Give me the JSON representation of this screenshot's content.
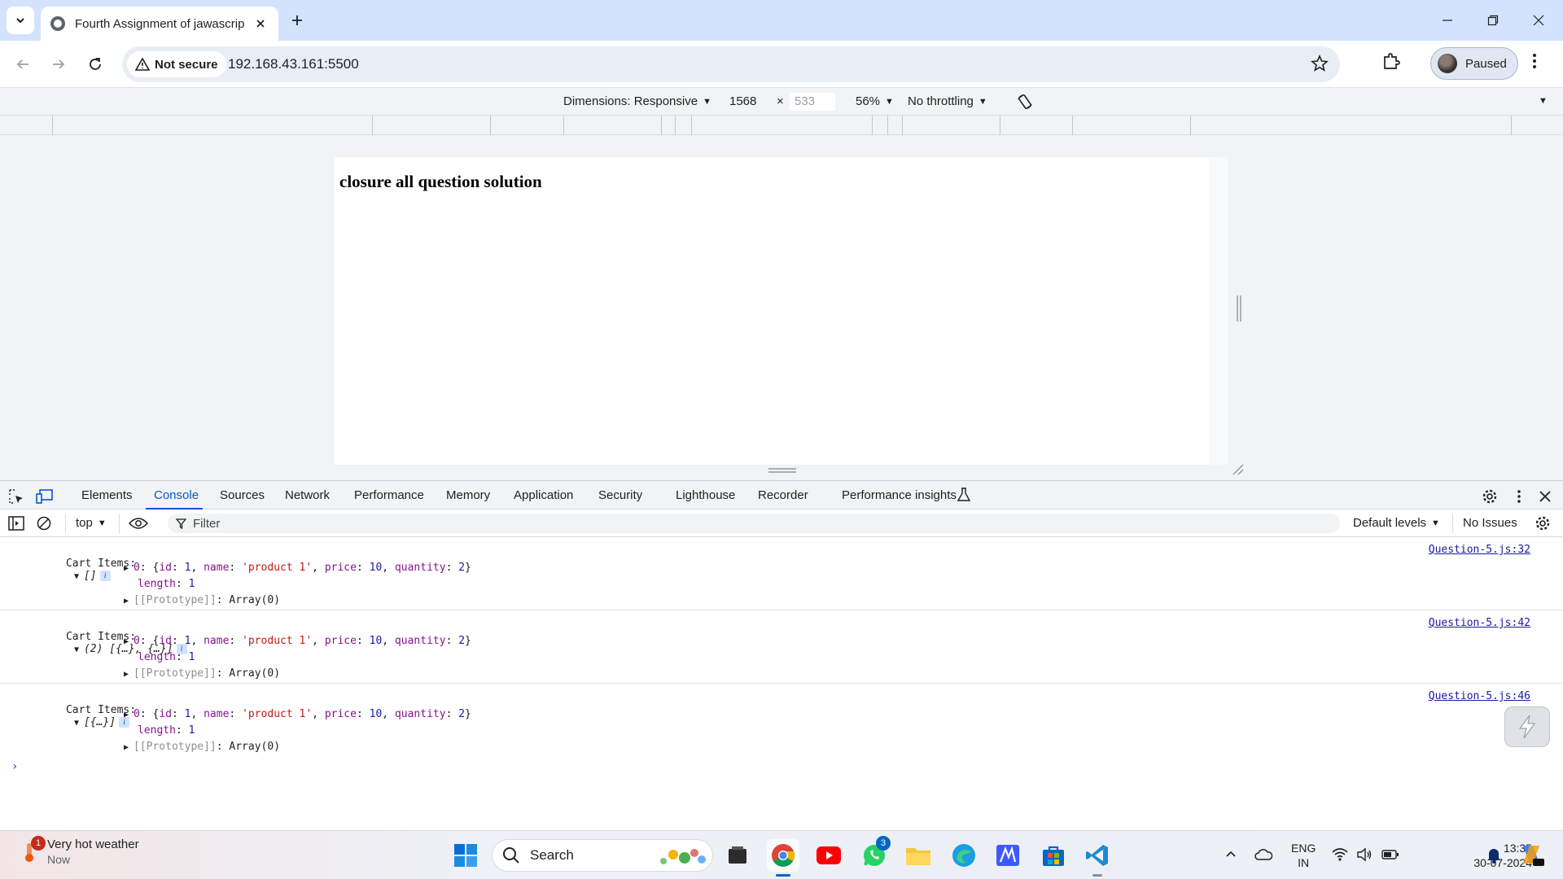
{
  "browser": {
    "tab_title": "Fourth Assignment of jawascrip",
    "security_label": "Not secure",
    "url": "192.168.43.161:5500",
    "profile_label": "Paused"
  },
  "device_toolbar": {
    "dimensions_label": "Dimensions: Responsive",
    "width": "1568",
    "times": "×",
    "height": "533",
    "zoom": "56%",
    "throttling": "No throttling"
  },
  "page": {
    "heading": "closure all question solution"
  },
  "devtools": {
    "tabs": [
      "Elements",
      "Console",
      "Sources",
      "Network",
      "Performance",
      "Memory",
      "Application",
      "Security",
      "Lighthouse",
      "Recorder",
      "Performance insights"
    ],
    "active_tab": "Console",
    "context": "top",
    "filter_placeholder": "Filter",
    "levels": "Default levels",
    "issues": "No Issues"
  },
  "console": {
    "logs": [
      {
        "label": "Cart Items:",
        "summary": "[]",
        "source": "Question-5.js:32",
        "item": {
          "index": "0",
          "id": "1",
          "name": "'product 1'",
          "price": "10",
          "quantity": "2"
        },
        "length": "1",
        "prototype": "Array(0)"
      },
      {
        "label": "Cart Items:",
        "summary": "(2) [{…}, {…}]",
        "source": "Question-5.js:42",
        "item": {
          "index": "0",
          "id": "1",
          "name": "'product 1'",
          "price": "10",
          "quantity": "2"
        },
        "length": "1",
        "prototype": "Array(0)"
      },
      {
        "label": "Cart Items:",
        "summary": "[{…}]",
        "source": "Question-5.js:46",
        "item": {
          "index": "0",
          "id": "1",
          "name": "'product 1'",
          "price": "10",
          "quantity": "2"
        },
        "length": "1",
        "prototype": "Array(0)"
      }
    ],
    "keys": {
      "id": "id",
      "name": "name",
      "price": "price",
      "quantity": "quantity",
      "length": "length",
      "prototype": "[[Prototype]]"
    },
    "prompt": "›"
  },
  "taskbar": {
    "weather_title": "Very hot weather",
    "weather_time": "Now",
    "weather_badge": "1",
    "search_label": "Search",
    "whatsapp_badge": "3",
    "lang_line1": "ENG",
    "lang_line2": "IN",
    "time": "13:35",
    "date": "30-07-2024"
  },
  "colors": {
    "tabstrip": "#d3e3fd",
    "accent": "#0b57d0",
    "string": "#c41a16",
    "number": "#1a1aa6",
    "key": "#881391"
  }
}
